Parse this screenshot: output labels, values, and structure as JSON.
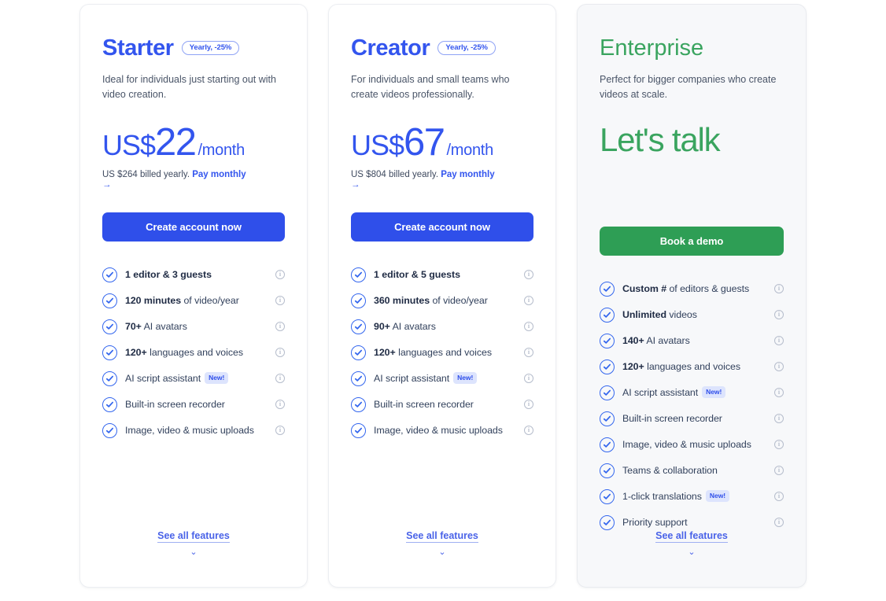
{
  "cards": [
    {
      "id": "starter",
      "plan_name": "Starter",
      "badge": "Yearly, -25%",
      "description": "Ideal for individuals just starting out with video creation.",
      "currency": "US$",
      "amount": "22",
      "period": "/month",
      "billed_note": "US $264 billed yearly.",
      "pay_monthly_link": "Pay monthly",
      "arrow": "→",
      "cta_label": "Create account now",
      "see_all_label": "See all features",
      "chevron": "⌄",
      "features": [
        {
          "bold": "1 editor & 3 guests",
          "rest": "",
          "new": ""
        },
        {
          "bold": "120 minutes",
          "rest": " of video/year",
          "new": ""
        },
        {
          "bold": "70+",
          "rest": " AI avatars",
          "new": ""
        },
        {
          "bold": "120+",
          "rest": " languages and voices",
          "new": ""
        },
        {
          "bold": "",
          "rest": "AI script assistant",
          "new": "New!"
        },
        {
          "bold": "",
          "rest": "Built-in screen recorder",
          "new": ""
        },
        {
          "bold": "",
          "rest": "Image, video & music uploads",
          "new": ""
        }
      ]
    },
    {
      "id": "creator",
      "plan_name": "Creator",
      "badge": "Yearly, -25%",
      "description": "For individuals and small teams who create videos professionally.",
      "currency": "US$",
      "amount": "67",
      "period": "/month",
      "billed_note": "US $804 billed yearly.",
      "pay_monthly_link": "Pay monthly",
      "arrow": "→",
      "cta_label": "Create account now",
      "see_all_label": "See all features",
      "chevron": "⌄",
      "features": [
        {
          "bold": "1 editor & 5 guests",
          "rest": "",
          "new": ""
        },
        {
          "bold": "360 minutes",
          "rest": " of video/year",
          "new": ""
        },
        {
          "bold": "90+",
          "rest": " AI avatars",
          "new": ""
        },
        {
          "bold": "120+",
          "rest": " languages and voices",
          "new": ""
        },
        {
          "bold": "",
          "rest": "AI script assistant",
          "new": "New!"
        },
        {
          "bold": "",
          "rest": "Built-in screen recorder",
          "new": ""
        },
        {
          "bold": "",
          "rest": "Image, video & music uploads",
          "new": ""
        }
      ]
    },
    {
      "id": "enterprise",
      "plan_name": "Enterprise",
      "badge": "",
      "description": "Perfect for bigger companies who create videos at scale.",
      "price_text": "Let's talk",
      "cta_label": "Book a demo",
      "see_all_label": "See all features",
      "chevron": "⌄",
      "features": [
        {
          "bold": "Custom #",
          "rest": " of editors & guests",
          "new": ""
        },
        {
          "bold": "Unlimited",
          "rest": " videos",
          "new": ""
        },
        {
          "bold": "140+",
          "rest": " AI avatars",
          "new": ""
        },
        {
          "bold": "120+",
          "rest": " languages and voices",
          "new": ""
        },
        {
          "bold": "",
          "rest": "AI script assistant",
          "new": "New!"
        },
        {
          "bold": "",
          "rest": "Built-in screen recorder",
          "new": ""
        },
        {
          "bold": "",
          "rest": "Image, video & music uploads",
          "new": ""
        },
        {
          "bold": "",
          "rest": "Teams & collaboration",
          "new": ""
        },
        {
          "bold": "",
          "rest": "1-click translations",
          "new": "New!"
        },
        {
          "bold": "",
          "rest": "Priority support",
          "new": ""
        }
      ]
    }
  ],
  "icons": {
    "check": "check-circle-icon",
    "info": "info-icon",
    "chevron_down": "chevron-down-icon",
    "arrow_right": "arrow-right-icon"
  },
  "colors": {
    "brand_blue": "#3355ee",
    "cta_blue": "#2f4fea",
    "enterprise_green": "#3aa45f",
    "cta_green": "#2e9e55",
    "badge_new_bg": "#dde4fd",
    "card_bg": "#ffffff",
    "enterprise_card_bg": "#f7f8fa"
  }
}
